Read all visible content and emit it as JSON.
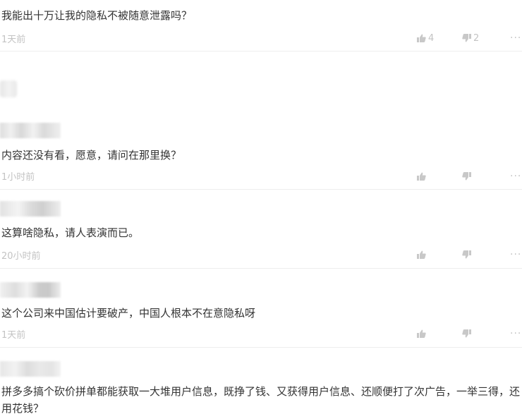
{
  "comments": [
    {
      "text": "我能出十万让我的隐私不被随意泄露吗？",
      "time": "1天前",
      "likes": "4",
      "dislikes": "2",
      "more": "···"
    },
    {
      "text": "内容还没有看，愿意，请问在那里换？",
      "time": "1小时前",
      "more": "···"
    },
    {
      "text": "这算啥隐私，请人表演而已。",
      "time": "20小时前",
      "more": "···"
    },
    {
      "text": "这个公司来中国估计要破产，中国人根本不在意隐私呀",
      "time": "1天前",
      "more": "···"
    },
    {
      "text": "拼多多搞个砍价拼单都能获取一大堆用户信息，既挣了钱、又获得用户信息、还顺便打了次广告，一举三得，还用花钱？"
    }
  ],
  "icons": {
    "like": "thumbs-up-icon",
    "dislike": "thumbs-down-icon",
    "more": "more-icon"
  },
  "colors": {
    "text": "#333333",
    "meta": "#c3c3c3",
    "divider": "#eeeeee"
  }
}
